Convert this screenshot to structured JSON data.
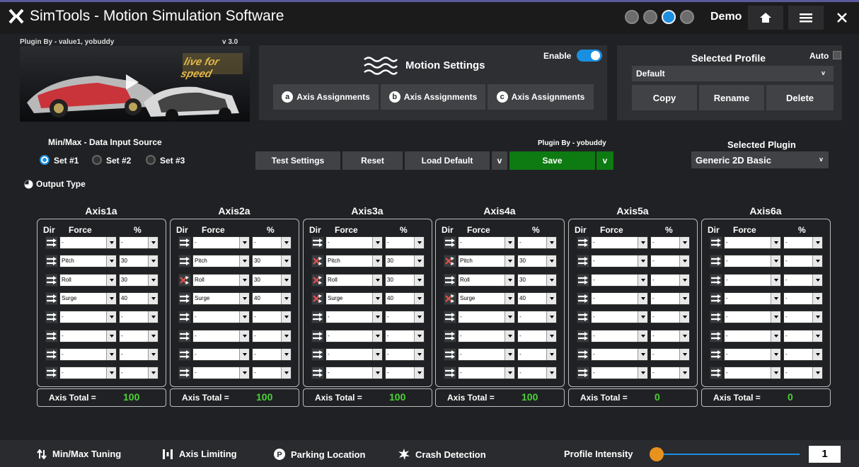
{
  "titlebar": {
    "title": "SimTools - Motion Simulation Software",
    "demo_label": "Demo"
  },
  "plugin": {
    "author": "Plugin By - value1, yobuddy",
    "version": "v 3.0",
    "game_logo_text": "live for speed"
  },
  "motion": {
    "title": "Motion Settings",
    "enable_label": "Enable",
    "enabled": true,
    "axis_buttons": [
      {
        "letter": "a",
        "label": "Axis Assignments"
      },
      {
        "letter": "b",
        "label": "Axis Assignments"
      },
      {
        "letter": "c",
        "label": "Axis Assignments"
      }
    ]
  },
  "profile": {
    "title": "Selected Profile",
    "auto_label": "Auto",
    "current": "Default",
    "copy": "Copy",
    "rename": "Rename",
    "delete": "Delete"
  },
  "data_source": {
    "title": "Min/Max - Data Input Source",
    "sets": [
      "Set #1",
      "Set #2",
      "Set #3"
    ],
    "selected": 0
  },
  "controls": {
    "test": "Test Settings",
    "reset": "Reset",
    "load_default": "Load Default",
    "save": "Save",
    "plugin_author": "Plugin By - yobuddy",
    "dropdown_glyph": "v"
  },
  "selected_plugin": {
    "title": "Selected Plugin",
    "value": "Generic 2D Basic"
  },
  "output_type": {
    "label": "Output Type"
  },
  "axes_header": {
    "dir": "Dir",
    "force": "Force",
    "pct": "%"
  },
  "axis_total_label": "Axis Total =",
  "axes": [
    {
      "name": "Axis1a",
      "total": "100",
      "rows": [
        {
          "dir": "straight",
          "force": "-",
          "pct": "-"
        },
        {
          "dir": "straight",
          "force": "Pitch",
          "pct": "30"
        },
        {
          "dir": "straight",
          "force": "Roll",
          "pct": "30"
        },
        {
          "dir": "straight",
          "force": "Surge",
          "pct": "40"
        },
        {
          "dir": "straight",
          "force": "-",
          "pct": "-"
        },
        {
          "dir": "straight",
          "force": "-",
          "pct": "-"
        },
        {
          "dir": "straight",
          "force": "-",
          "pct": "-"
        },
        {
          "dir": "straight",
          "force": "-",
          "pct": "-"
        }
      ]
    },
    {
      "name": "Axis2a",
      "total": "100",
      "rows": [
        {
          "dir": "straight",
          "force": "-",
          "pct": "-"
        },
        {
          "dir": "straight",
          "force": "Pitch",
          "pct": "30"
        },
        {
          "dir": "invert",
          "force": "Roll",
          "pct": "30"
        },
        {
          "dir": "straight",
          "force": "Surge",
          "pct": "40"
        },
        {
          "dir": "straight",
          "force": "-",
          "pct": "-"
        },
        {
          "dir": "straight",
          "force": "-",
          "pct": "-"
        },
        {
          "dir": "straight",
          "force": "-",
          "pct": "-"
        },
        {
          "dir": "straight",
          "force": "-",
          "pct": "-"
        }
      ]
    },
    {
      "name": "Axis3a",
      "total": "100",
      "rows": [
        {
          "dir": "straight",
          "force": "-",
          "pct": "-"
        },
        {
          "dir": "invert",
          "force": "Pitch",
          "pct": "30"
        },
        {
          "dir": "invert",
          "force": "Roll",
          "pct": "30"
        },
        {
          "dir": "invert",
          "force": "Surge",
          "pct": "40"
        },
        {
          "dir": "straight",
          "force": "-",
          "pct": "-"
        },
        {
          "dir": "straight",
          "force": "-",
          "pct": "-"
        },
        {
          "dir": "straight",
          "force": "-",
          "pct": "-"
        },
        {
          "dir": "straight",
          "force": "-",
          "pct": "-"
        }
      ]
    },
    {
      "name": "Axis4a",
      "total": "100",
      "rows": [
        {
          "dir": "straight",
          "force": "-",
          "pct": "-"
        },
        {
          "dir": "invert",
          "force": "Pitch",
          "pct": "30"
        },
        {
          "dir": "straight",
          "force": "Roll",
          "pct": "30"
        },
        {
          "dir": "invert",
          "force": "Surge",
          "pct": "40"
        },
        {
          "dir": "straight",
          "force": "-",
          "pct": "-"
        },
        {
          "dir": "straight",
          "force": "-",
          "pct": "-"
        },
        {
          "dir": "straight",
          "force": "-",
          "pct": "-"
        },
        {
          "dir": "straight",
          "force": "-",
          "pct": "-"
        }
      ]
    },
    {
      "name": "Axis5a",
      "total": "0",
      "rows": [
        {
          "dir": "straight",
          "force": "-",
          "pct": "-"
        },
        {
          "dir": "straight",
          "force": "-",
          "pct": "-"
        },
        {
          "dir": "straight",
          "force": "-",
          "pct": "-"
        },
        {
          "dir": "straight",
          "force": "-",
          "pct": "-"
        },
        {
          "dir": "straight",
          "force": "-",
          "pct": "-"
        },
        {
          "dir": "straight",
          "force": "-",
          "pct": "-"
        },
        {
          "dir": "straight",
          "force": "-",
          "pct": "-"
        },
        {
          "dir": "straight",
          "force": "-",
          "pct": "-"
        }
      ]
    },
    {
      "name": "Axis6a",
      "total": "0",
      "rows": [
        {
          "dir": "straight",
          "force": "-",
          "pct": "-"
        },
        {
          "dir": "straight",
          "force": "-",
          "pct": "-"
        },
        {
          "dir": "straight",
          "force": "-",
          "pct": "-"
        },
        {
          "dir": "straight",
          "force": "-",
          "pct": "-"
        },
        {
          "dir": "straight",
          "force": "-",
          "pct": "-"
        },
        {
          "dir": "straight",
          "force": "-",
          "pct": "-"
        },
        {
          "dir": "straight",
          "force": "-",
          "pct": "-"
        },
        {
          "dir": "straight",
          "force": "-",
          "pct": "-"
        }
      ]
    }
  ],
  "bottom": {
    "minmax": "Min/Max Tuning",
    "limiting": "Axis Limiting",
    "parking": "Parking Location",
    "crash": "Crash Detection",
    "intensity_label": "Profile Intensity",
    "intensity_value": "1",
    "intensity_level": 0
  },
  "colors": {
    "accent_blue": "#1a8fe0",
    "save_green": "#0e7a12",
    "total_green": "#4cd137",
    "invert_red": "#e05050"
  }
}
